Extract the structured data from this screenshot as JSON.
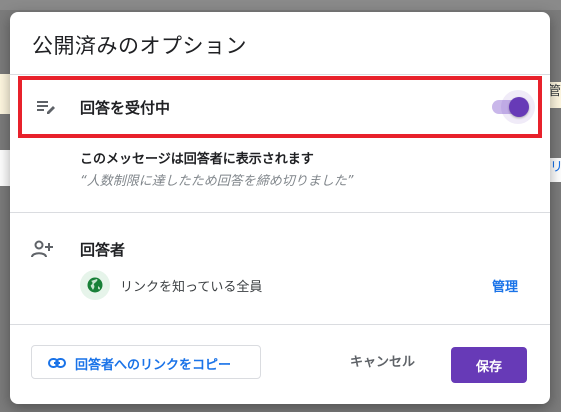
{
  "dialog": {
    "title": "公開済みのオプション",
    "accepting": {
      "label": "回答を受付中",
      "enabled": true,
      "icon": "edit-list-icon",
      "message_heading": "このメッセージは回答者に表示されます",
      "message_quote": "“人数制限に達したため回答を締め切りました”"
    },
    "responders": {
      "label": "回答者",
      "icon": "person-add-icon",
      "access_icon": "globe-icon",
      "access_label": "リンクを知っている全員",
      "manage_label": "管理"
    },
    "footer": {
      "copy_link_label": "回答者へのリンクをコピー",
      "copy_icon": "link-icon",
      "cancel_label": "キャンセル",
      "save_label": "保存"
    }
  },
  "background": {
    "right_edge_text_1": "管",
    "right_edge_text_2": "リ"
  },
  "colors": {
    "accent": "#673ab7",
    "link": "#1a73e8",
    "highlight": "#e8212b",
    "globe": "#188038"
  }
}
